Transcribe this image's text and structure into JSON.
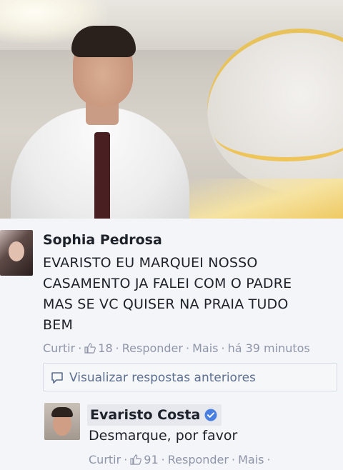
{
  "post": {
    "photo_alt": "photo"
  },
  "comment1": {
    "author": "Sophia Pedrosa",
    "text_lines": [
      "EVARISTO EU MARQUEI NOSSO",
      "CASAMENTO JA FALEI COM O PADRE",
      "MAS SE VC QUISER NA PRAIA TUDO",
      "BEM"
    ],
    "actions": {
      "like": "Curtir",
      "like_count": "18",
      "reply": "Responder",
      "more": "Mais",
      "time": "há 39 minutos"
    }
  },
  "replies_link": {
    "label": "Visualizar respostas anteriores"
  },
  "comment2": {
    "author": "Evaristo Costa",
    "text": "Desmarque, por favor",
    "actions": {
      "like": "Curtir",
      "like_count": "91",
      "reply": "Responder",
      "more": "Mais"
    }
  },
  "colors": {
    "meta_text": "#8e95a8",
    "link_blue": "#5c6f91",
    "verified_blue": "#4a7fe2"
  },
  "icons": [
    "thumbs-up-icon",
    "comment-bubble-icon",
    "verified-badge-icon"
  ]
}
